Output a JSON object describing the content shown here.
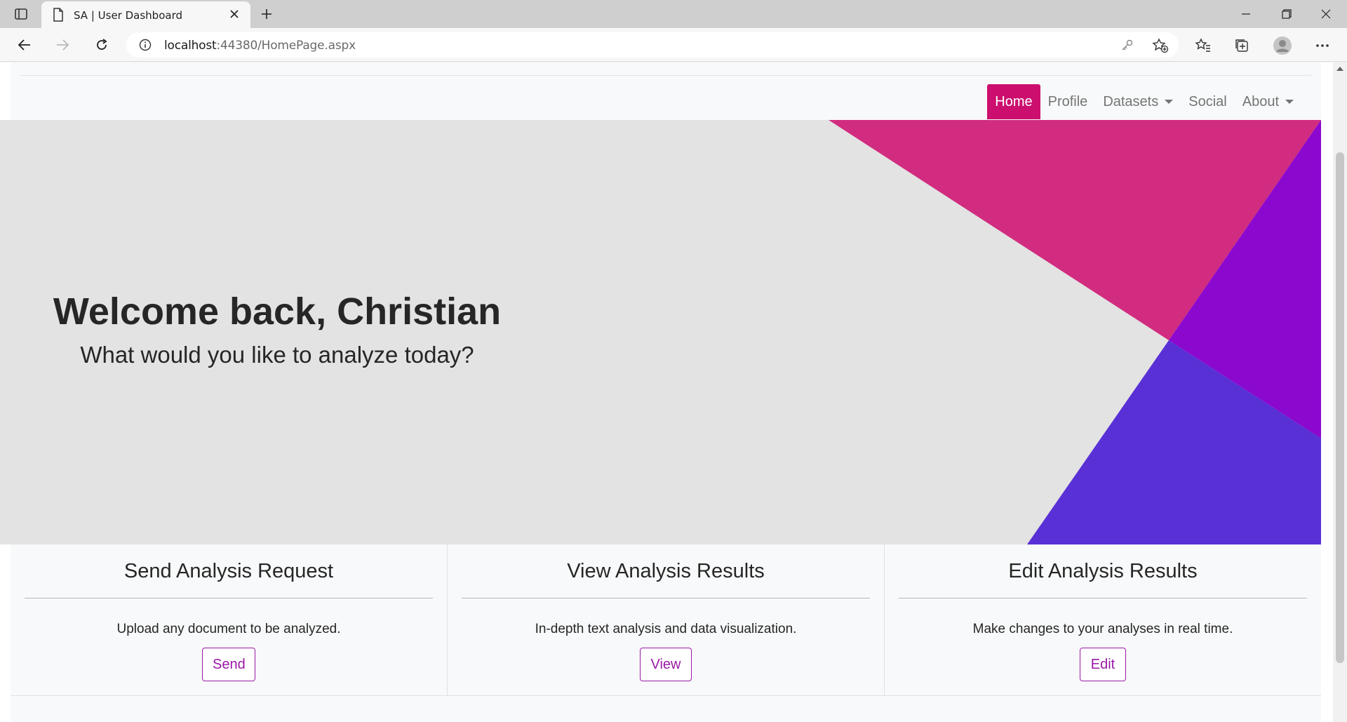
{
  "browser": {
    "tab_title": "SA | User Dashboard",
    "url_host": "localhost",
    "url_rest": ":44380/HomePage.aspx"
  },
  "navbar": {
    "items": [
      {
        "label": "Home",
        "active": true,
        "dropdown": false
      },
      {
        "label": "Profile",
        "active": false,
        "dropdown": false
      },
      {
        "label": "Datasets",
        "active": false,
        "dropdown": true
      },
      {
        "label": "Social",
        "active": false,
        "dropdown": false
      },
      {
        "label": "About",
        "active": false,
        "dropdown": true
      }
    ]
  },
  "hero": {
    "headline": "Welcome back, Christian",
    "subline": "What would you like to analyze today?"
  },
  "cards": [
    {
      "title": "Send Analysis Request",
      "description": "Upload any document to be analyzed.",
      "button": "Send"
    },
    {
      "title": "View Analysis Results",
      "description": "In-depth text analysis and data visualization.",
      "button": "View"
    },
    {
      "title": "Edit Analysis Results",
      "description": "Make changes to your analyses in real time.",
      "button": "Edit"
    }
  ],
  "colors": {
    "accent": "#cc0f6e",
    "button_outline": "#9b18a6",
    "hero_pink": "#d12c7f",
    "hero_purple": "#8b08cf",
    "hero_indigo": "#5930d6",
    "hero_bg": "#e3e3e3"
  }
}
